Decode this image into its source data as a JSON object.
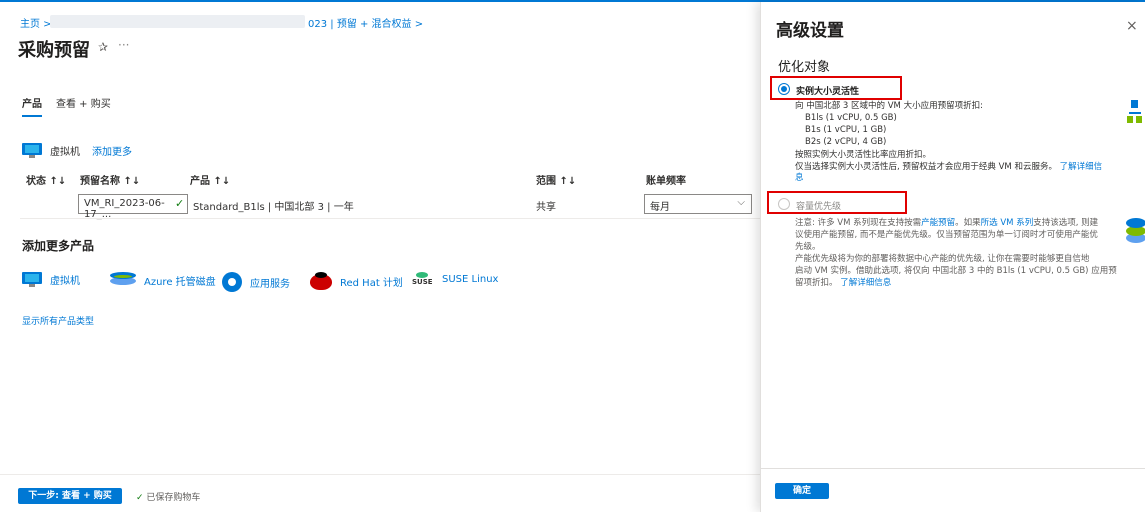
{
  "breadcrumb": {
    "home": "主页 >",
    "tail": "023 | 预留 + 混合权益 >"
  },
  "page": {
    "title": "采购预留",
    "pin": "✰",
    "more": "···"
  },
  "tabs": [
    {
      "label": "产品"
    },
    {
      "label": "查看 + 购买"
    }
  ],
  "section": {
    "label": "虚拟机",
    "add_more": "添加更多"
  },
  "table": {
    "headers": {
      "status": "状态 ↑↓",
      "name": "预留名称 ↑↓",
      "product": "产品 ↑↓",
      "scope": "范围 ↑↓",
      "billing": "账单频率"
    },
    "row": {
      "name": "VM_RI_2023-06-17_...",
      "product": "Standard_B1ls | 中国北部 3 | 一年",
      "scope": "共享",
      "billing": "每月"
    }
  },
  "add_products": {
    "title": "添加更多产品",
    "items": [
      {
        "label": "虚拟机",
        "icon": "vm-icon"
      },
      {
        "label": "Azure 托管磁盘",
        "icon": "disk-icon"
      },
      {
        "label": "应用服务",
        "icon": "app-service-icon"
      },
      {
        "label": "Red Hat 计划",
        "icon": "redhat-icon"
      },
      {
        "label": "SUSE Linux",
        "icon": "suse-icon"
      }
    ],
    "suse_word": "SUSE",
    "show_all": "显示所有产品类型"
  },
  "footer": {
    "next": "下一步: 查看 + 购买",
    "saved": "已保存购物车"
  },
  "panel": {
    "title": "高级设置",
    "close": "×",
    "subtitle": "优化对象",
    "option1": {
      "label": "实例大小灵活性",
      "lines": [
        "向 中国北部 3 区域中的 VM 大小应用预留项折扣:",
        "B1ls (1 vCPU, 0.5 GB)",
        "B1s (1 vCPU, 1 GB)",
        "B2s (2 vCPU, 4 GB)",
        "按照实例大小灵活性比率应用折扣。",
        "仅当选择实例大小灵活性后, 预留权益才会应用于经典 VM 和云服务。"
      ],
      "link1": "了解详细信",
      "link2": "息"
    },
    "option2": {
      "label": "容量优先级",
      "l1a": "注意: 许多 VM 系列现在支持按需",
      "l1link1": "产能预留",
      "l1b": "。如果",
      "l1link2": "所选 VM 系列",
      "l1c": "支持该选项, 则建",
      "l2": "议使用产能预留, 而不是产能优先级。仅当预留范围为单一订阅时才可使用产能优",
      "l3": "先级。",
      "l4": "产能优先级将为你的部署将数据中心产能的优先级, 让你在需要时能够更自信地",
      "l5": "启动 VM 实例。借助此选项, 将仅向 中国北部 3 中的 B1ls (1 vCPU, 0.5 GB) 应用预",
      "l6a": "留项折扣。",
      "l6link": "了解详细信息"
    },
    "ok": "确定"
  },
  "colors": {
    "accent": "#0078d4",
    "highlight": "#e00000",
    "success": "#107c10"
  }
}
